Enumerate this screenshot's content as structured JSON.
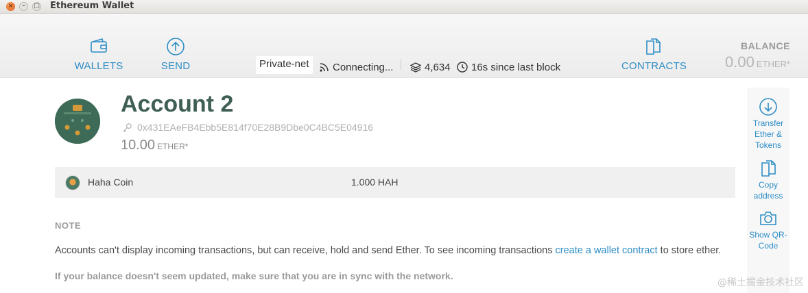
{
  "window": {
    "title": "Ethereum Wallet",
    "close_glyph": "×",
    "min_glyph": "–",
    "max_glyph": "□"
  },
  "nav": {
    "wallets": {
      "label": "WALLETS",
      "icon": "wallet-icon"
    },
    "send": {
      "label": "SEND",
      "icon": "arrow-up-circle-icon"
    },
    "contracts": {
      "label": "CONTRACTS",
      "icon": "documents-icon"
    }
  },
  "status": {
    "network": "Private-net",
    "connection": "Connecting...",
    "block_number": "4,634",
    "last_block": "16s since last block"
  },
  "balance": {
    "label": "BALANCE",
    "value": "0.00",
    "unit": "ETHER*"
  },
  "account": {
    "name": "Account 2",
    "address": "0x431EAeFB4Ebb5E814f70E28B9Dbe0C4BC5E04916",
    "balance": "10.00",
    "unit": "ETHER*"
  },
  "tokens": [
    {
      "name": "Haha Coin",
      "value": "1.000 HAH"
    }
  ],
  "note": {
    "heading": "NOTE",
    "text_before": "Accounts can't display incoming transactions, but can receive, hold and send Ether. To see incoming transactions ",
    "link": "create a wallet contract",
    "text_after": " to store ether.",
    "sync": "If your balance doesn't seem updated, make sure that you are in sync with the network."
  },
  "actions": {
    "transfer": {
      "line1": "Transfer",
      "line2": "Ether &",
      "line3": "Tokens"
    },
    "copy": {
      "line1": "Copy",
      "line2": "address"
    },
    "qr": {
      "line1": "Show QR-",
      "line2": "Code"
    }
  },
  "watermark": "@稀土掘金技术社区",
  "colors": {
    "accent": "#2d8dc5",
    "account_title": "#3f5f54",
    "avatar": "#3e6b57"
  }
}
